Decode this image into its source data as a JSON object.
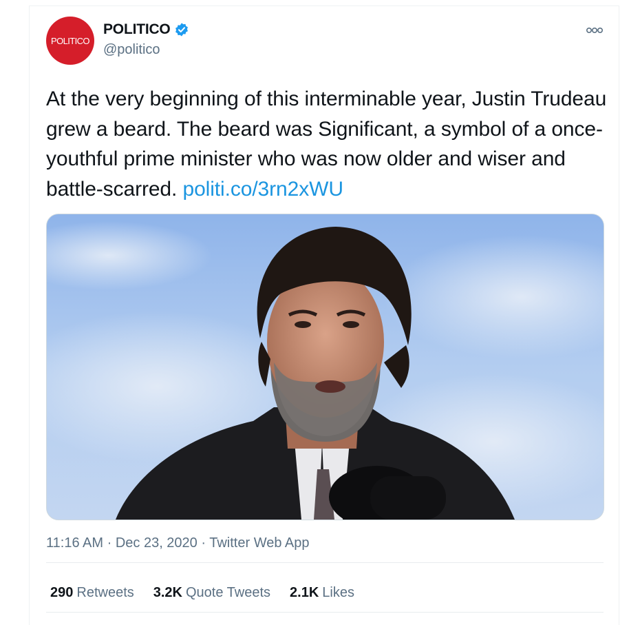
{
  "account": {
    "avatar_text": "POLITICO",
    "display_name": "POLITICO",
    "handle": "@politico",
    "verified": true,
    "avatar_color": "#d51e2a",
    "verified_color": "#1d9bf0"
  },
  "tweet": {
    "text": "At the very beginning of this interminable year, Justin Trudeau grew a beard. The beard was Significant, a symbol of a once-youthful prime minister who was now older and wiser and battle-scarred.",
    "link": "politi.co/3rn2xWU",
    "link_color": "#1b95e0",
    "image_description_icon": "photo-of-man-speaking-at-microphone"
  },
  "meta": {
    "time": "11:16 AM",
    "date": "Dec 23, 2020",
    "source": "Twitter Web App",
    "separator": "·"
  },
  "stats": {
    "retweets_count": "290",
    "retweets_label": "Retweets",
    "quote_count": "3.2K",
    "quote_label": "Quote Tweets",
    "likes_count": "2.1K",
    "likes_label": "Likes"
  }
}
